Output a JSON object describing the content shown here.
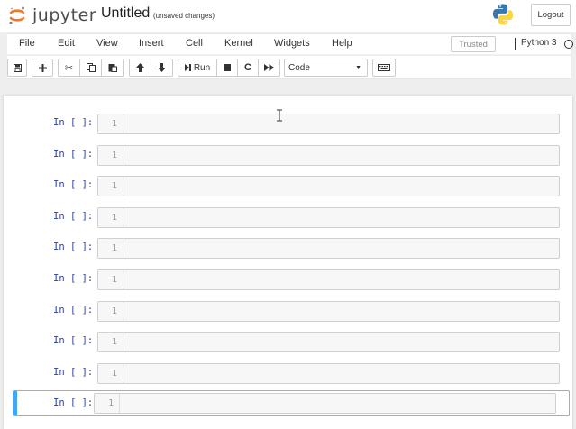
{
  "header": {
    "logo_text": "jupyter",
    "notebook_name": "Untitled",
    "save_status": "(unsaved changes)",
    "logout_label": "Logout"
  },
  "menubar": {
    "items": [
      "File",
      "Edit",
      "View",
      "Insert",
      "Cell",
      "Kernel",
      "Widgets",
      "Help"
    ],
    "trusted_label": "Trusted",
    "kernel_name": "Python 3"
  },
  "toolbar": {
    "save_icon": "save-icon",
    "add_icon": "plus-icon",
    "cut_icon": "scissors-icon",
    "copy_icon": "copy-icon",
    "paste_icon": "paste-icon",
    "up_icon": "arrow-up-icon",
    "down_icon": "arrow-down-icon",
    "run_label": "Run",
    "stop_icon": "stop-icon",
    "restart_icon": "refresh-icon",
    "fast_forward_icon": "fast-forward-icon",
    "cell_type": "Code",
    "keyboard_icon": "keyboard-icon"
  },
  "cells": [
    {
      "prompt": "In [ ]:",
      "line": "1",
      "selected": false
    },
    {
      "prompt": "In [ ]:",
      "line": "1",
      "selected": false
    },
    {
      "prompt": "In [ ]:",
      "line": "1",
      "selected": false
    },
    {
      "prompt": "In [ ]:",
      "line": "1",
      "selected": false
    },
    {
      "prompt": "In [ ]:",
      "line": "1",
      "selected": false
    },
    {
      "prompt": "In [ ]:",
      "line": "1",
      "selected": false
    },
    {
      "prompt": "In [ ]:",
      "line": "1",
      "selected": false
    },
    {
      "prompt": "In [ ]:",
      "line": "1",
      "selected": false
    },
    {
      "prompt": "In [ ]:",
      "line": "1",
      "selected": false
    },
    {
      "prompt": "In [ ]:",
      "line": "1",
      "selected": true
    }
  ],
  "colors": {
    "accent": "#f37726",
    "selected_border": "#42a5f5",
    "prompt": "#303f9f"
  }
}
